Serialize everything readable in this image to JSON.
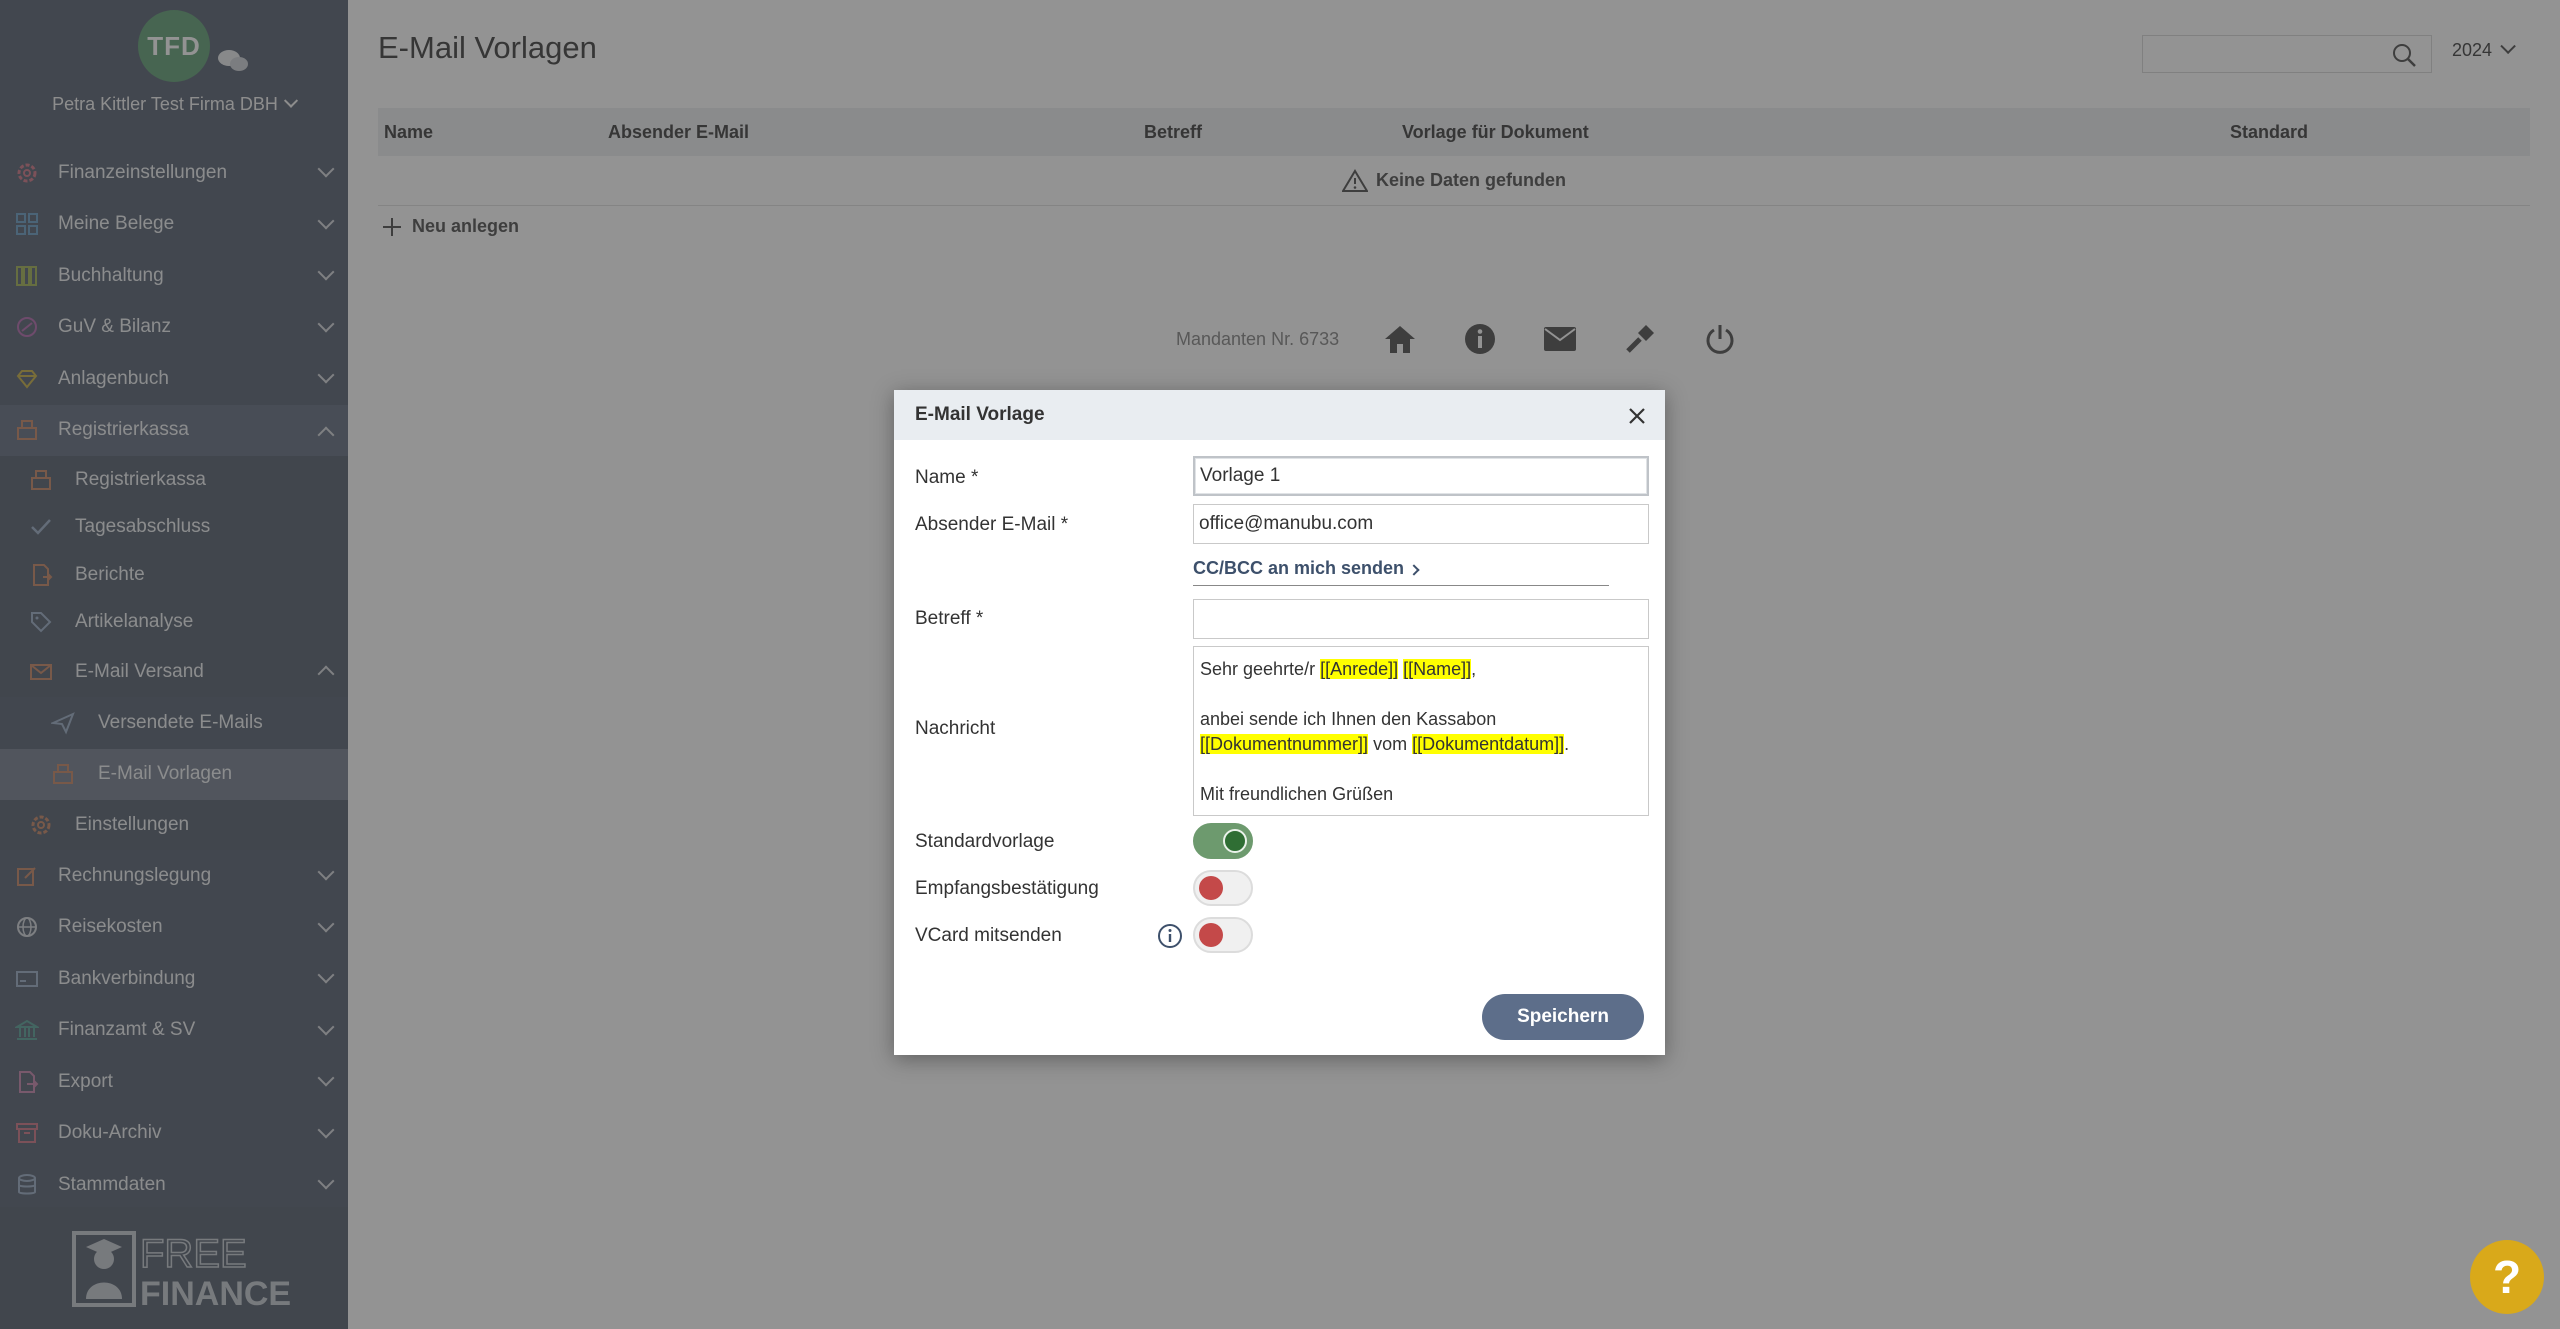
{
  "sidebar": {
    "logo_text": "TFD",
    "company": "Petra Kittler Test Firma DBH",
    "items": [
      {
        "label": "Finanzeinstellungen",
        "icon": "gear-icon"
      },
      {
        "label": "Meine Belege",
        "icon": "grid-icon"
      },
      {
        "label": "Buchhaltung",
        "icon": "books-icon"
      },
      {
        "label": "GuV & Bilanz",
        "icon": "chart-circle-icon"
      },
      {
        "label": "Anlagenbuch",
        "icon": "diamond-icon"
      },
      {
        "label": "Registrierkassa",
        "icon": "register-icon"
      }
    ],
    "register_sub": [
      {
        "label": "Registrierkassa",
        "icon": "register-icon"
      },
      {
        "label": "Tagesabschluss",
        "icon": "check-icon"
      },
      {
        "label": "Berichte",
        "icon": "report-icon"
      },
      {
        "label": "Artikelanalyse",
        "icon": "tag-icon"
      },
      {
        "label": "E-Mail Versand",
        "icon": "mail-send-icon"
      }
    ],
    "email_sub": [
      {
        "label": "Versendete E-Mails",
        "icon": "paper-plane-icon"
      },
      {
        "label": "E-Mail Vorlagen",
        "icon": "template-icon"
      }
    ],
    "settings": {
      "label": "Einstellungen",
      "icon": "gear-icon"
    },
    "items_after": [
      {
        "label": "Rechnungslegung",
        "icon": "edit-icon"
      },
      {
        "label": "Reisekosten",
        "icon": "globe-icon"
      },
      {
        "label": "Bankverbindung",
        "icon": "bank-card-icon"
      },
      {
        "label": "Finanzamt & SV",
        "icon": "building-icon"
      },
      {
        "label": "Export",
        "icon": "export-icon"
      },
      {
        "label": "Doku-Archiv",
        "icon": "archive-icon"
      },
      {
        "label": "Stammdaten",
        "icon": "database-icon"
      }
    ],
    "footer_logo_top": "FREE",
    "footer_logo_bottom": "FINANCE"
  },
  "main": {
    "title": "E-Mail Vorlagen",
    "search_placeholder": "",
    "year": "2024",
    "table": {
      "headers": [
        "Name",
        "Absender E-Mail",
        "Betreff",
        "Vorlage für Dokument",
        "Standard"
      ],
      "empty": "Keine Daten gefunden"
    },
    "new_label": "Neu anlegen",
    "footer": {
      "client_number": "Mandanten Nr. 6733"
    }
  },
  "modal": {
    "title": "E-Mail Vorlage",
    "name_label": "Name *",
    "name_value": "Vorlage 1",
    "sender_label": "Absender E-Mail *",
    "sender_value": "office@manubu.com",
    "cc_link": "CC/BCC an mich senden",
    "subject_label": "Betreff *",
    "subject_value": "",
    "message_label": "Nachricht",
    "message": {
      "l1_pre": "Sehr geehrte/r ",
      "l1_h1": "[[Anrede]]",
      "l1_h2": "[[Name]]",
      "l1_post": ",",
      "l3": "anbei sende ich Ihnen den Kassabon",
      "l4_h1": "[[Dokumentnummer]]",
      "l4_mid": " vom ",
      "l4_h2": "[[Dokumentdatum]]",
      "l4_post": ".",
      "l6": "Mit freundlichen Grüßen"
    },
    "standard_label": "Standardvorlage",
    "standard_on": true,
    "receipt_label": "Empfangsbestätigung",
    "receipt_on": false,
    "vcard_label": "VCard mitsenden",
    "vcard_on": false,
    "save_label": "Speichern"
  },
  "help_label": "?",
  "colors": {
    "toggle_on": "#6d9a6e",
    "toggle_off_knob": "#c44949",
    "save": "#5d6e8a",
    "help": "#d9a91a",
    "highlight": "#ffff00"
  }
}
